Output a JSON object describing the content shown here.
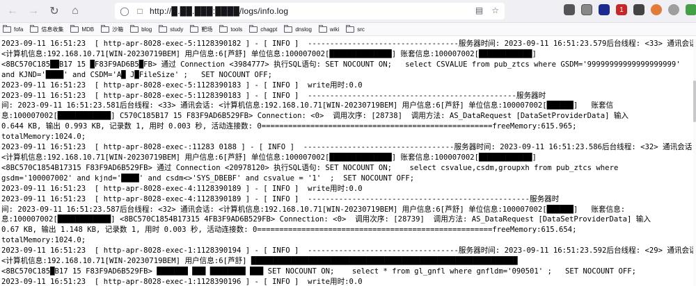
{
  "browser": {
    "url": "http://█.██.███:████/logs/info.log",
    "bookmarks": [
      "fofa",
      "信息收集",
      "MDB",
      "沙箱",
      "blog",
      "study",
      "靶场",
      "tools",
      "chagpt",
      "dnslog",
      "wiki",
      "src"
    ],
    "ext_badge": "1"
  },
  "log_lines": [
    "2023-09-11 16:51:23  [ http-apr-8028-exec-5:1128390182 ] - [ INFO ]  ----------------------------------服务器时间: 2023-09-11 16:51:23.579后台线程: <33> 通讯会话:",
    "<计算机信息:192.168.10.71[WIN-20230719BEM] 用户信息:6[芦舒] 单位信息:100007002[██████████████] 账套信息:100007002[████████████]",
    "<8BC570C185██B17 15 █F83F9AD6B5█FB> 通过 Connection <3984777> 执行SQL语句: SET NOCOUNT ON;   select CSVALUE from pub_ztcs where GSDM='99999999999999999999'",
    "and KJND='████' and CSDM='A█ J█FileSize' ;   SET NOCOUNT OFF;",
    "2023-09-11 16:51:23  [ http-apr-8028-exec-5:1128390183 ] - [ INFO ]  write用时:0.0",
    "2023-09-11 16:51:23  [ http-apr-8028-exec-5:1128390183 ] - [ INFO ]  -----------------------------------------------服务器时",
    "间: 2023-09-11 16:51:23.581后台线程: <33> 通讯会话: <计算机信息:192.168.10.71[WIN-20230719BEM] 用户信息:6[芦舒] 单位信息:100007002[██████]   账套信",
    "息:100007002[████████████] C570C185B17 15 F83F9AD6B529FB> Connection: <0>  调用次序: [28738]  调用方法: AS_DataRequest [DataSetProviderData] 输入",
    "0.644 KB, 输出 0.993 KB, 记录数 1, 用时 0.003 秒, 活动连接数: 0====================================================freeMemory:615.965;",
    "totalMemory:1024.0;",
    "2023-09-11 16:51:23  [ http-apr-8028-exec-:11283 0188 ] - [ INFO ]  ----------------------------------服务器时间: 2023-09-11 16:51:23.586后台线程: <32> 通讯会话:",
    "<计算机信息:192.168.10.71[WIN-20230719BEM] 用户信息:6[芦舒] 单位信息:100007002[██████████████] 账套信息:100007002[████████████]",
    "<8BC570C1854B17315 F83F9AD6B529FB> 通过 Connection <20978120> 执行SQL语句: SET NOCOUNT ON;    select csvalue,csdm,groupxh from pub_ztcs where",
    "gsdm='100007002' and kjnd='████' and csdm<>'SYS_DBEBF' and csvalue = '1'  ;  SET NOCOUNT OFF;",
    "2023-09-11 16:51:23  [ http-apr-8028-exec-4:1128390189 ] - [ INFO ]  write用时:0.0",
    "2023-09-11 16:51:23  [ http-apr-8028-exec-4:1128390189 ] - [ INFO ]  --------------------------------------------------服务器时",
    "间: 2023-09-11 16:51:23.587后台线程: <32> 通讯会话: <计算机信息:192.168.10.71[WIN-20230719BEM] 用户信息:6[芦舒] 单位信息:100007002[██████]   账套信息:",
    "息:100007002[████████████] <8BC570C1854B17315 4FB3F9AD6B529FB> Connection: <0>  调用次序: [28739]  调用方法: AS_DataRequest [DataSetProviderData] 输入",
    "0.67 KB, 输出 1.148 KB, 记录数 1, 用时 0.003 秒, 活动连接数: 0=====================================================freeMemory:615.654;",
    "totalMemory:1024.0;",
    "2023-09-11 16:51:23  [ http-apr-8028-exec-1:1128390194 ] - [ INFO ]  ----------------------------------服务器时间: 2023-09-11 16:51:23.592后台线程: <29> 通讯会话:",
    "<计算机信息:192.168.10.71[WIN-20230719BEM] 用户信息:6[芦舒] ████████████████████████████████████████████████████████████",
    "<8BC570C185█B17 15 F83F9AD6B529FB> ███████ ███ ████████ ███ SET NOCOUNT ON;    select * from gl_gnfl where gnfldm='090501' ;   SET NOCOUNT OFF;",
    "2023-09-11 16:51:23  [ http-apr-8028-exec-1:1128390196 ] - [ INFO ]  write用时:0.0"
  ]
}
